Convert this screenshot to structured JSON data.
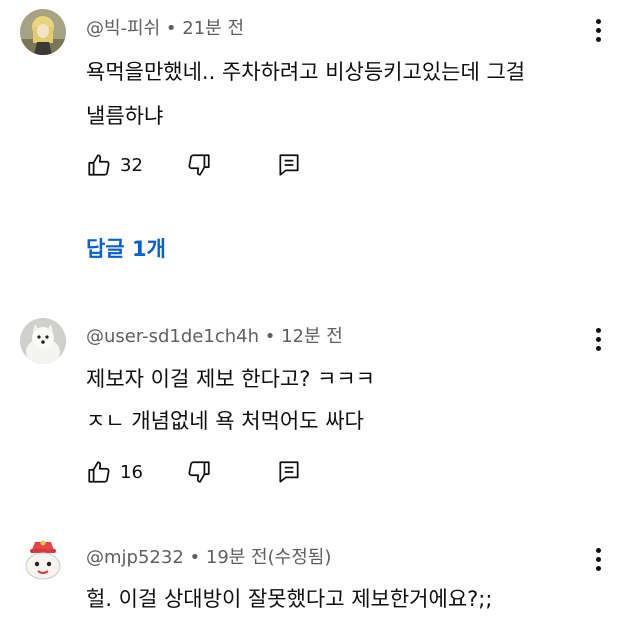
{
  "comments": [
    {
      "author": "@빅-피쉬",
      "time": "21분 전",
      "lines": [
        "욕먹을만했네.. 주차하려고 비상등키고있는데 그걸",
        "낼름하냐"
      ],
      "likes": "32",
      "avatar_icon": "blonde-figure-avatar"
    },
    {
      "author": "@user-sd1de1ch4h",
      "time": "12분 전",
      "lines": [
        "제보자 이걸 제보 한다고? ㅋㅋㅋ",
        "ㅈㄴ 개념없네 욕 처먹어도 싸다"
      ],
      "likes": "16",
      "avatar_icon": "white-dog-avatar"
    },
    {
      "author": "@mjp5232",
      "time": "19분 전(수정됨)",
      "lines": [
        "헐. 이걸 상대방이 잘못했다고 제보한거에요?;;"
      ],
      "avatar_icon": "cartoon-character-avatar"
    }
  ],
  "replies_label": "답글 1개",
  "separator": "•",
  "colors": {
    "link": "#065fd4",
    "meta": "#606060",
    "text": "#0f0f0f"
  }
}
